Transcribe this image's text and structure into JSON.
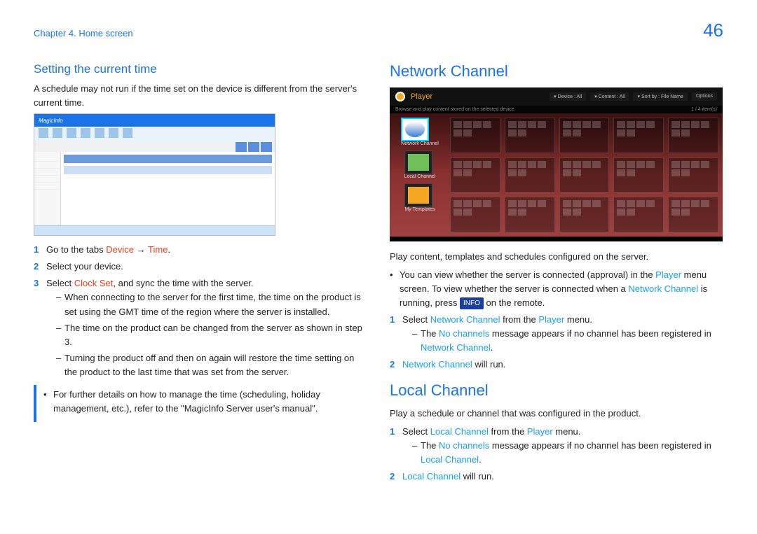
{
  "header": {
    "chapter": "Chapter 4. Home screen",
    "page": "46"
  },
  "left": {
    "h_setting": "Setting the current time",
    "intro": "A schedule may not run if the time set on the device is different from the server's current time.",
    "step1_a": "Go to the tabs ",
    "step1_b": "Device",
    "step1_c": " → ",
    "step1_d": "Time",
    "step1_e": ".",
    "step2": "Select your device.",
    "step3_a": "Select ",
    "step3_b": "Clock Set",
    "step3_c": ", and sync the time with the server.",
    "sub1": "When connecting to the server for the first time, the time on the product is set using the GMT time of the region where the server is installed.",
    "sub2": "The time on the product can be changed from the server as shown in step 3.",
    "sub3": "Turning the product off and then on again will restore the time setting on the product to the last time that was set from the server.",
    "callout": "For further details on how to manage the time (scheduling, holiday management, etc.), refer to the \"MagicInfo Server user's manual\"."
  },
  "right": {
    "h_net": "Network Channel",
    "player_title": "Player",
    "f_dev": "Device : All",
    "f_con": "Content : All",
    "f_sort": "Sort by : File Name",
    "f_opt": "Options",
    "subline": "Browse and play content stored on the selected device.",
    "count": "1 / 4 item(s)",
    "lbl_net": "Network Channel",
    "lbl_loc": "Local Channel",
    "lbl_my": "My Templates",
    "p_play": "Play content, templates and schedules configured on the server.",
    "b1_a": "You can view whether the server is connected (approval) in the ",
    "b1_b": "Player",
    "b1_c": " menu screen. To view whether the server is connected when a ",
    "b1_d": "Network Channel",
    "b1_e": " is running, press ",
    "b1_f": "INFO",
    "b1_g": " on the remote.",
    "n1_a": "Select ",
    "n1_b": "Network Channel",
    "n1_c": " from the ",
    "n1_d": "Player",
    "n1_e": " menu.",
    "n1s_a": "The ",
    "n1s_b": "No channels",
    "n1s_c": " message appears if no channel has been registered in ",
    "n1s_d": "Network Channel",
    "n1s_e": ".",
    "n2_a": "Network Channel",
    "n2_b": " will run.",
    "h_loc": "Local Channel",
    "loc_intro": "Play a schedule or channel that was configured in the product.",
    "l1_a": "Select ",
    "l1_b": "Local Channel",
    "l1_c": " from the ",
    "l1_d": "Player",
    "l1_e": " menu.",
    "l1s_a": "The ",
    "l1s_b": "No channels",
    "l1s_c": " message appears if no channel has been registered in ",
    "l1s_d": "Local Channel",
    "l1s_e": ".",
    "l2_a": "Local Channel",
    "l2_b": " will run."
  }
}
